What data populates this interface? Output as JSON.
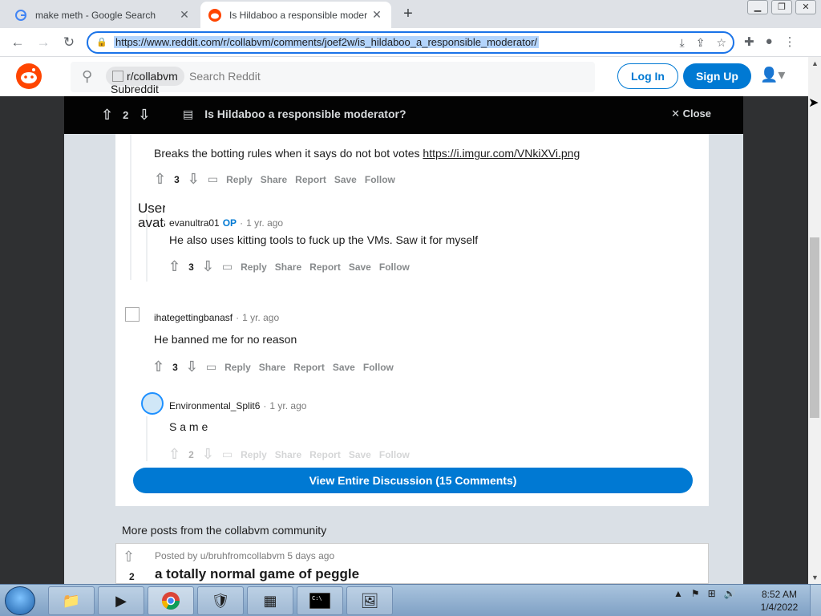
{
  "browser": {
    "tabs": [
      {
        "title": "make meth - Google Search",
        "favicon": "google-icon"
      },
      {
        "title": "Is Hildaboo a responsible moder",
        "favicon": "reddit-icon"
      }
    ],
    "url": "https://www.reddit.com/r/collabvm/comments/joef2w/is_hildaboo_a_responsible_moderator/"
  },
  "header": {
    "subreddit_chip": "r/collabvm",
    "search_placeholder": "Search Reddit",
    "subreddit_alt": "Subreddit",
    "login": "Log In",
    "signup": "Sign Up"
  },
  "postbar": {
    "score": "2",
    "title": "Is Hildaboo a responsible moderator?",
    "close": "Close"
  },
  "comments": [
    {
      "body": "Breaks the botting rules when it says do not bot votes ",
      "link": "https://i.imgur.com/VNkiXVi.png",
      "score": "3"
    },
    {
      "user": "evanultra01",
      "op": "OP",
      "time": "1 yr. ago",
      "body": "He also uses kitting tools to fuck up the VMs. Saw it for myself",
      "score": "3"
    },
    {
      "user": "ihategettingbanasf",
      "time": "1 yr. ago",
      "body": "He banned me for no reason",
      "score": "3"
    },
    {
      "user": "Environmental_Split6",
      "time": "1 yr. ago",
      "body": "S a m e",
      "score": "2"
    }
  ],
  "actions": {
    "reply": "Reply",
    "share": "Share",
    "report": "Report",
    "save": "Save",
    "follow": "Follow"
  },
  "avatar_alt": "User avatar",
  "view_all": "View Entire Discussion (15 Comments)",
  "more_posts": {
    "heading": "More posts from the collabvm community",
    "posted_by": "Posted by u/bruhfromcollabvm 5 days ago",
    "score": "2",
    "title": "a totally normal game of peggle"
  },
  "taskbar": {
    "time": "8:52 AM",
    "date": "1/4/2022"
  }
}
